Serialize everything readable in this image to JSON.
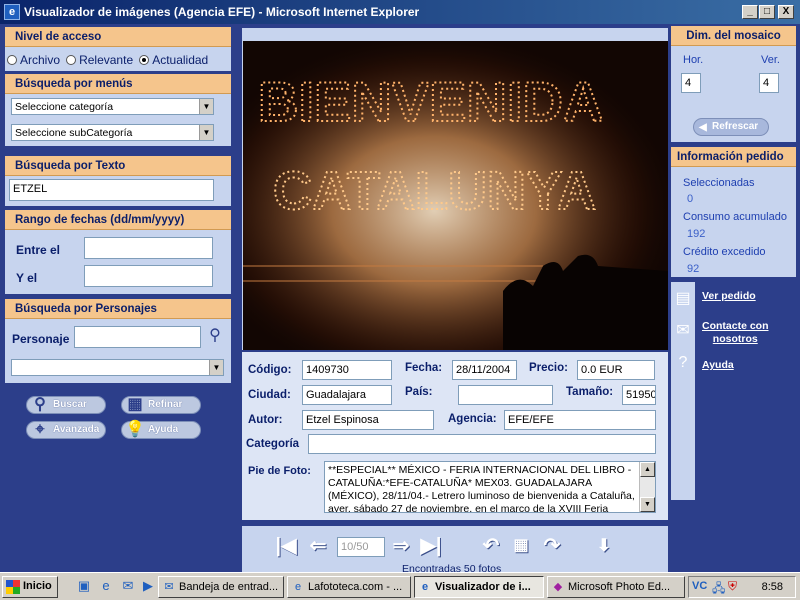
{
  "window": {
    "title": "Visualizador de imágenes (Agencia EFE) - Microsoft Internet Explorer",
    "minimize": "_",
    "maximize": "□",
    "close": "X"
  },
  "access_level": {
    "header": "Nivel de acceso",
    "options": [
      "Archivo",
      "Relevante",
      "Actualidad"
    ],
    "selected": "Actualidad"
  },
  "menu_search": {
    "header": "Búsqueda por menús",
    "category_select": "Seleccione categoría",
    "subcategory_select": "Seleccione subCategoría"
  },
  "text_search": {
    "header": "Búsqueda por Texto",
    "value": "ETZEL"
  },
  "date_range": {
    "header": "Rango de fechas (dd/mm/yyyy)",
    "from_label": "Entre el",
    "to_label": "Y el",
    "from_value": "",
    "to_value": ""
  },
  "person_search": {
    "header": "Búsqueda por Personajes",
    "label": "Personaje",
    "value": "",
    "select_value": ""
  },
  "actions": {
    "buscar": "Buscar",
    "refinar": "Refinar",
    "avanzada": "Avanzada",
    "ayuda": "Ayuda"
  },
  "photo": {
    "sign_line1": "BIENVENIDA",
    "sign_line2": "CATALUNYA"
  },
  "details": {
    "codigo_label": "Código:",
    "codigo": "1409730",
    "fecha_label": "Fecha:",
    "fecha": "28/11/2004",
    "precio_label": "Precio:",
    "precio": "0.0  EUR",
    "ciudad_label": "Ciudad:",
    "ciudad": "Guadalajara",
    "pais_label": "País:",
    "pais": "",
    "tamano_label": "Tamaño:",
    "tamano": "51950",
    "autor_label": "Autor:",
    "autor": "Etzel Espinosa",
    "agencia_label": "Agencia:",
    "agencia": "EFE/EFE",
    "categoria_label": "Categoría",
    "categoria": "",
    "pie_label": "Pie de Foto:",
    "pie": "**ESPECIAL** MÉXICO - FERIA INTERNACIONAL DEL LIBRO - CATALUÑA:*EFE-CATALUÑA* MEX03. GUADALAJARA (MÉXICO), 28/11/04.- Letrero luminoso de bienvenida a Cataluña, ayer, sábado 27 de noviembre, en el marco de la XVIII Feria"
  },
  "navigation": {
    "page": "10/50",
    "found": "Encontradas 50 fotos"
  },
  "mosaic": {
    "header": "Dim. del mosaico",
    "hor_label": "Hor.",
    "ver_label": "Ver.",
    "hor_value": "4",
    "ver_value": "4",
    "refresh": "Refrescar"
  },
  "order_info": {
    "header": "Información pedido",
    "selected_label": "Seleccionadas",
    "selected_value": "0",
    "consumption_label": "Consumo acumulado",
    "consumption_value": "192",
    "credit_label": "Crédito excedido",
    "credit_value": "92"
  },
  "links": {
    "ver_pedido": "Ver pedido",
    "contacte_1": "Contacte con",
    "contacte_2": "nosotros",
    "ayuda": "Ayuda"
  },
  "taskbar": {
    "start": "Inicio",
    "tasks": [
      {
        "label": "Bandeja de entrad..."
      },
      {
        "label": "Lafototeca.com - ..."
      },
      {
        "label": "Visualizador de i..."
      },
      {
        "label": "Microsoft Photo Ed..."
      }
    ],
    "active_task_index": 2,
    "clock": "8:58"
  }
}
